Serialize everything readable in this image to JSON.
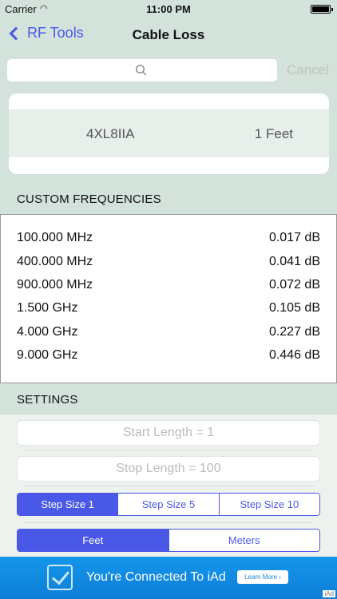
{
  "status_bar": {
    "carrier": "Carrier",
    "wifi_icon": "◠",
    "time": "11:00 PM"
  },
  "nav": {
    "back_label": "RF Tools",
    "title": "Cable Loss"
  },
  "search": {
    "placeholder": "",
    "cancel_label": "Cancel"
  },
  "selection": {
    "cable": "4XL8IIA",
    "length": "1 Feet"
  },
  "custom_frequencies": {
    "header": "CUSTOM FREQUENCIES",
    "rows": [
      {
        "freq": "100.000 MHz",
        "loss": "0.017 dB"
      },
      {
        "freq": "400.000 MHz",
        "loss": "0.041 dB"
      },
      {
        "freq": "900.000 MHz",
        "loss": "0.072 dB"
      },
      {
        "freq": "1.500 GHz",
        "loss": "0.105 dB"
      },
      {
        "freq": "4.000 GHz",
        "loss": "0.227 dB"
      },
      {
        "freq": "9.000 GHz",
        "loss": "0.446 dB"
      }
    ]
  },
  "settings": {
    "header": "SETTINGS",
    "start_length": "Start Length = 1",
    "stop_length": "Stop Length = 100",
    "step_sizes": [
      "Step Size 1",
      "Step Size 5",
      "Step Size 10"
    ],
    "step_selected": "Step Size 1",
    "units": [
      "Feet",
      "Meters"
    ],
    "unit_selected": "Feet"
  },
  "ad": {
    "text": "You're Connected To iAd",
    "button": "Learn More ›",
    "tag": "iAd"
  },
  "colors": {
    "accent": "#4a58e8",
    "background": "#d3e2da",
    "ad_blue": "#1496ea"
  }
}
